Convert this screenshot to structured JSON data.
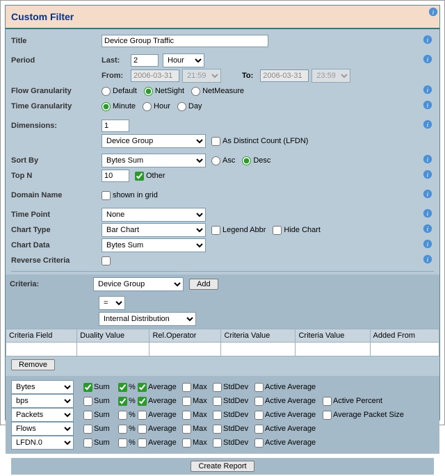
{
  "title_bar": "Custom Filter",
  "labels": {
    "title": "Title",
    "period": "Period",
    "last": "Last:",
    "from": "From:",
    "to": "To:",
    "flow_gran": "Flow Granularity",
    "time_gran": "Time Granularity",
    "dimensions": "Dimensions:",
    "as_distinct": "As Distinct Count (LFDN)",
    "sort_by": "Sort By",
    "asc": "Asc",
    "desc": "Desc",
    "top_n": "Top N",
    "other": "Other",
    "domain_name": "Domain Name",
    "shown_in_grid": "shown in grid",
    "time_point": "Time Point",
    "chart_type": "Chart Type",
    "legend_abbr": "Legend Abbr",
    "hide_chart": "Hide Chart",
    "chart_data": "Chart Data",
    "reverse_criteria": "Reverse Criteria",
    "criteria": "Criteria:",
    "add": "Add",
    "remove": "Remove",
    "create_report": "Create Report"
  },
  "values": {
    "title": "Device Group Traffic",
    "last_n": "2",
    "last_unit": "Hour",
    "from_date": "2006-03-31",
    "from_time": "21:59",
    "to_date": "2006-03-31",
    "to_time": "23:59",
    "dimensions_n": "1",
    "dimension_sel": "Device Group",
    "sort_by": "Bytes Sum",
    "top_n": "10",
    "time_point": "None",
    "chart_type": "Bar Chart",
    "chart_data": "Bytes Sum",
    "criteria_sel": "Device Group",
    "op": "=",
    "scope": "Internal Distribution"
  },
  "radios": {
    "flow": {
      "default": "Default",
      "netsight": "NetSight",
      "netmeasure": "NetMeasure"
    },
    "time": {
      "minute": "Minute",
      "hour": "Hour",
      "day": "Day"
    }
  },
  "grid_headers": {
    "criteria_field": "Criteria Field",
    "duality_value": "Duality Value",
    "rel_operator": "Rel.Operator",
    "criteria_value": "Criteria Value",
    "criteria_value2": "Criteria Value",
    "added_from": "Added From"
  },
  "metric_labels": {
    "sum": "Sum",
    "pct": "%",
    "avg": "Average",
    "max": "Max",
    "std": "StdDev",
    "active_avg": "Active Average",
    "active_pct": "Active Percent",
    "avg_pkt_size": "Average Packet Size"
  },
  "metrics": [
    {
      "name": "Bytes",
      "sum": true,
      "pct": true,
      "avg": true,
      "max": false,
      "std": false,
      "aavg": false,
      "tail": ""
    },
    {
      "name": "bps",
      "sum": false,
      "pct": true,
      "avg": true,
      "max": false,
      "std": false,
      "aavg": false,
      "tail": "active_pct"
    },
    {
      "name": "Packets",
      "sum": false,
      "pct": false,
      "avg": false,
      "max": false,
      "std": false,
      "aavg": false,
      "tail": "avg_pkt_size"
    },
    {
      "name": "Flows",
      "sum": false,
      "pct": false,
      "avg": false,
      "max": false,
      "std": false,
      "aavg": false,
      "tail": ""
    },
    {
      "name": "LFDN.0",
      "sum": false,
      "pct": false,
      "avg": false,
      "max": false,
      "std": false,
      "aavg": false,
      "tail": ""
    }
  ]
}
